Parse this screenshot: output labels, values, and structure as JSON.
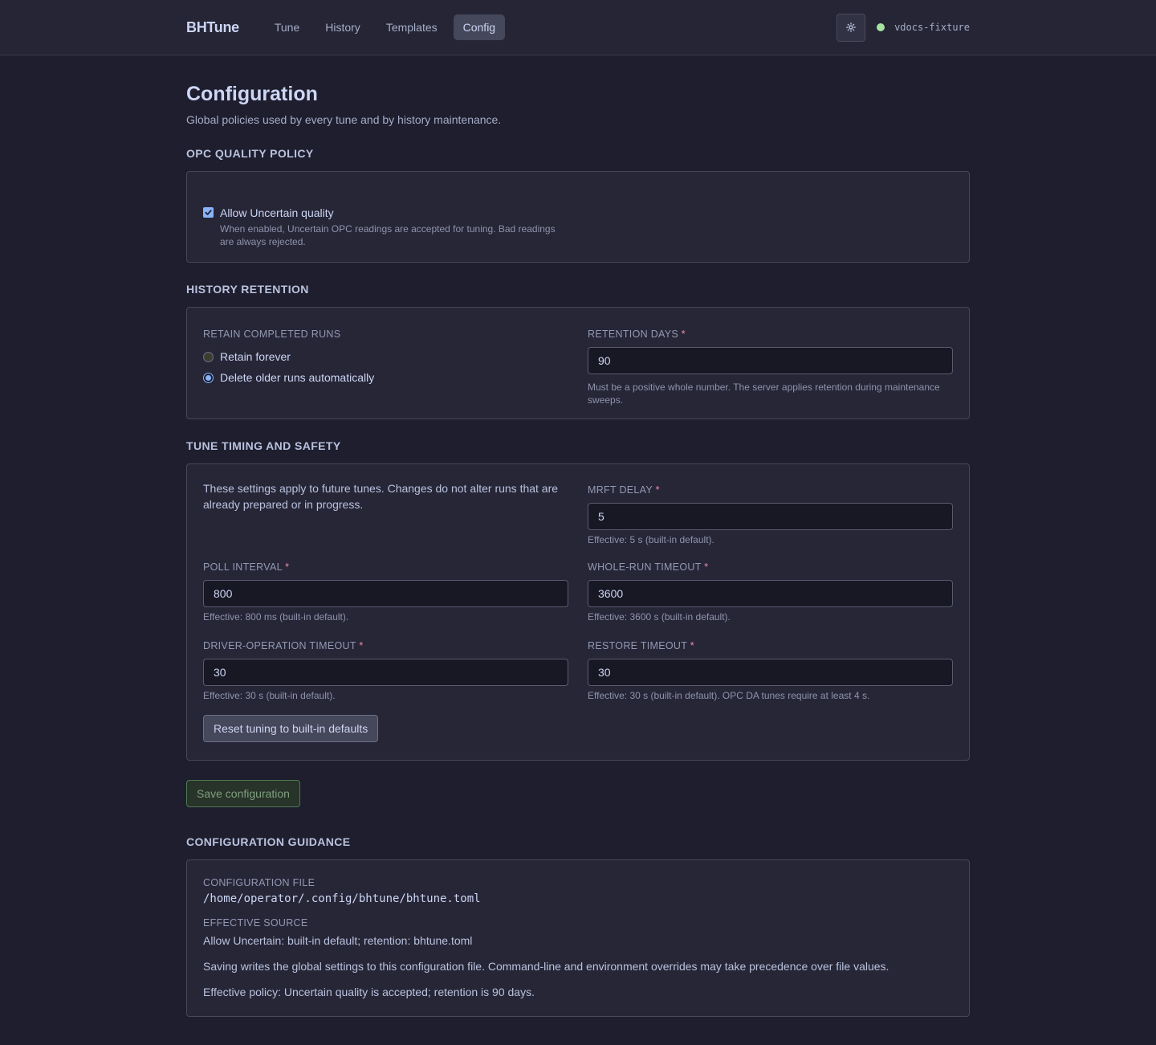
{
  "header": {
    "brand": "BHTune",
    "nav": [
      "Tune",
      "History",
      "Templates",
      "Config"
    ],
    "active_nav": "Config",
    "server_name": "vdocs-fixture",
    "status_color": "#a6e3a1",
    "theme_icon": "sun-icon"
  },
  "page": {
    "title": "Configuration",
    "subtitle": "Global policies used by every tune and by history maintenance."
  },
  "opc": {
    "section_title": "OPC QUALITY POLICY",
    "checkbox_label": "Allow Uncertain quality",
    "checked": true,
    "hint": "When enabled, Uncertain OPC readings are accepted for tuning. Bad readings are always rejected."
  },
  "retention": {
    "section_title": "HISTORY RETENTION",
    "group_label": "RETAIN COMPLETED RUNS",
    "options": [
      "Retain forever",
      "Delete older runs automatically"
    ],
    "selected_index": 1,
    "days_label": "RETENTION DAYS",
    "required_mark": "*",
    "days_value": "90",
    "days_hint": "Must be a positive whole number. The server applies retention during maintenance sweeps."
  },
  "timing": {
    "section_title": "TUNE TIMING AND SAFETY",
    "intro": "These settings apply to future tunes. Changes do not alter runs that are already prepared or in progress.",
    "mrft": {
      "label": "MRFT DELAY",
      "value": "5",
      "hint": "Effective: 5 s (built-in default)."
    },
    "poll": {
      "label": "POLL INTERVAL",
      "value": "800",
      "hint": "Effective: 800 ms (built-in default)."
    },
    "whole_run": {
      "label": "WHOLE-RUN TIMEOUT",
      "value": "3600",
      "hint": "Effective: 3600 s (built-in default)."
    },
    "driver": {
      "label": "DRIVER-OPERATION TIMEOUT",
      "value": "30",
      "hint": "Effective: 30 s (built-in default)."
    },
    "restore": {
      "label": "RESTORE TIMEOUT",
      "value": "30",
      "hint": "Effective: 30 s (built-in default). OPC DA tunes require at least 4 s."
    },
    "reset_button": "Reset tuning to built-in defaults"
  },
  "save_button": "Save configuration",
  "guidance": {
    "section_title": "CONFIGURATION GUIDANCE",
    "file_label": "CONFIGURATION FILE",
    "file_path": "/home/operator/.config/bhtune/bhtune.toml",
    "source_label": "EFFECTIVE SOURCE",
    "source_value": "Allow Uncertain: built-in default; retention: bhtune.toml",
    "note": "Saving writes the global settings to this configuration file. Command-line and environment overrides may take precedence over file values.",
    "policy": "Effective policy: Uncertain quality is accepted; retention is 90 days."
  }
}
